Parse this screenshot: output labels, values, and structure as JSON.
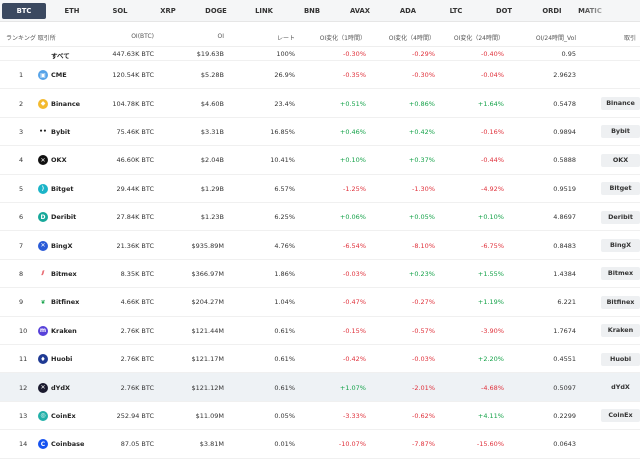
{
  "tabs": [
    "BTC",
    "ETH",
    "SOL",
    "XRP",
    "DOGE",
    "LINK",
    "BNB",
    "AVAX",
    "ADA",
    "LTC",
    "DOT",
    "ORDI",
    "MATIC"
  ],
  "header": {
    "rank": "ランキング 取引所",
    "oi_btc": "OI(BTC)",
    "oi": "OI",
    "rate": "レート",
    "chg_1h": "OI変化（1時間）",
    "chg_4h": "OI変化（4時間）",
    "chg_24h": "OI変化（24時間）",
    "oi_vol": "OI/24時間_Vol",
    "link": "取引"
  },
  "colors": {
    "tab_active": "#3b4960",
    "negative": "#e0323c",
    "positive": "#16a34a"
  },
  "rows": [
    {
      "rank": "",
      "name": "すべて",
      "icon": "",
      "btc": "447.63K BTC",
      "oi": "$19.63B",
      "rate": "100%",
      "h1": "-0.30%",
      "h4": "-0.29%",
      "h24": "-0.40%",
      "vol": "0.95",
      "btn": ""
    },
    {
      "rank": "1",
      "name": "CME",
      "icon": "cme-icon",
      "btc": "120.54K BTC",
      "oi": "$5.28B",
      "rate": "26.9%",
      "h1": "-0.35%",
      "h4": "-0.30%",
      "h24": "-0.04%",
      "vol": "2.9623",
      "btn": ""
    },
    {
      "rank": "2",
      "name": "Binance",
      "icon": "binance-icon",
      "btc": "104.78K BTC",
      "oi": "$4.60B",
      "rate": "23.4%",
      "h1": "+0.51%",
      "h4": "+0.86%",
      "h24": "+1.64%",
      "vol": "0.5478",
      "btn": "Binance"
    },
    {
      "rank": "3",
      "name": "Bybit",
      "icon": "bybit-icon",
      "btc": "75.46K BTC",
      "oi": "$3.31B",
      "rate": "16.85%",
      "h1": "+0.46%",
      "h4": "+0.42%",
      "h24": "-0.16%",
      "vol": "0.9894",
      "btn": "Bybit"
    },
    {
      "rank": "4",
      "name": "OKX",
      "icon": "okx-icon",
      "btc": "46.60K BTC",
      "oi": "$2.04B",
      "rate": "10.41%",
      "h1": "+0.10%",
      "h4": "+0.37%",
      "h24": "-0.44%",
      "vol": "0.5888",
      "btn": "OKX"
    },
    {
      "rank": "5",
      "name": "Bitget",
      "icon": "bitget-icon",
      "btc": "29.44K BTC",
      "oi": "$1.29B",
      "rate": "6.57%",
      "h1": "-1.25%",
      "h4": "-1.30%",
      "h24": "-4.92%",
      "vol": "0.9519",
      "btn": "Bitget"
    },
    {
      "rank": "6",
      "name": "Deribit",
      "icon": "deribit-icon",
      "btc": "27.84K BTC",
      "oi": "$1.23B",
      "rate": "6.25%",
      "h1": "+0.06%",
      "h4": "+0.05%",
      "h24": "+0.10%",
      "vol": "4.8697",
      "btn": "Deribit"
    },
    {
      "rank": "7",
      "name": "BingX",
      "icon": "bingx-icon",
      "btc": "21.36K BTC",
      "oi": "$935.89M",
      "rate": "4.76%",
      "h1": "-6.54%",
      "h4": "-8.10%",
      "h24": "-6.75%",
      "vol": "0.8483",
      "btn": "BingX"
    },
    {
      "rank": "8",
      "name": "Bitmex",
      "icon": "bitmex-icon",
      "btc": "8.35K BTC",
      "oi": "$366.97M",
      "rate": "1.86%",
      "h1": "-0.03%",
      "h4": "+0.23%",
      "h24": "+1.55%",
      "vol": "1.4384",
      "btn": "Bitmex"
    },
    {
      "rank": "9",
      "name": "Bitfinex",
      "icon": "bitfinex-icon",
      "btc": "4.66K BTC",
      "oi": "$204.27M",
      "rate": "1.04%",
      "h1": "-0.47%",
      "h4": "-0.27%",
      "h24": "+1.19%",
      "vol": "6.221",
      "btn": "Bitfinex"
    },
    {
      "rank": "10",
      "name": "Kraken",
      "icon": "kraken-icon",
      "btc": "2.76K BTC",
      "oi": "$121.44M",
      "rate": "0.61%",
      "h1": "-0.15%",
      "h4": "-0.57%",
      "h24": "-3.90%",
      "vol": "1.7674",
      "btn": "Kraken"
    },
    {
      "rank": "11",
      "name": "Huobi",
      "icon": "huobi-icon",
      "btc": "2.76K BTC",
      "oi": "$121.17M",
      "rate": "0.61%",
      "h1": "-0.42%",
      "h4": "-0.03%",
      "h24": "+2.20%",
      "vol": "0.4551",
      "btn": "Huobi"
    },
    {
      "rank": "12",
      "name": "dYdX",
      "icon": "dydx-icon",
      "btc": "2.76K BTC",
      "oi": "$121.12M",
      "rate": "0.61%",
      "h1": "+1.07%",
      "h4": "-2.01%",
      "h24": "-4.68%",
      "vol": "0.5097",
      "btn": "dYdX"
    },
    {
      "rank": "13",
      "name": "CoinEx",
      "icon": "coinex-icon",
      "btc": "252.94 BTC",
      "oi": "$11.09M",
      "rate": "0.05%",
      "h1": "-3.33%",
      "h4": "-0.62%",
      "h24": "+4.11%",
      "vol": "0.2299",
      "btn": "CoinEx"
    },
    {
      "rank": "14",
      "name": "Coinbase",
      "icon": "coinbase-icon",
      "btc": "87.05 BTC",
      "oi": "$3.81M",
      "rate": "0.01%",
      "h1": "-10.07%",
      "h4": "-7.87%",
      "h24": "-15.60%",
      "vol": "0.0643",
      "btn": ""
    }
  ]
}
